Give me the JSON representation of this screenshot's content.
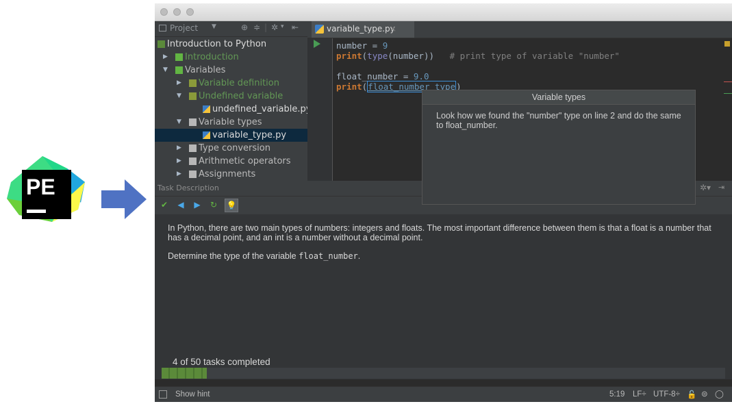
{
  "logo": {
    "text": "PE"
  },
  "window": {
    "project_panel": {
      "label": "Project",
      "tree": [
        {
          "label": "Introduction to Python",
          "depth": 0,
          "arrow": "",
          "style": "course"
        },
        {
          "label": "Introduction",
          "depth": 1,
          "arrow": "▶",
          "style": "green"
        },
        {
          "label": "Variables",
          "depth": 1,
          "arrow": "▼",
          "style": "normal"
        },
        {
          "label": "Variable definition",
          "depth": 2,
          "arrow": "▶",
          "style": "green"
        },
        {
          "label": "Undefined variable",
          "depth": 2,
          "arrow": "▼",
          "style": "green"
        },
        {
          "label": "undefined_variable.py",
          "depth": 3,
          "arrow": "",
          "style": "file"
        },
        {
          "label": "Variable types",
          "depth": 2,
          "arrow": "▼",
          "style": "normal"
        },
        {
          "label": "variable_type.py",
          "depth": 3,
          "arrow": "",
          "style": "file-selected"
        },
        {
          "label": "Type conversion",
          "depth": 2,
          "arrow": "▶",
          "style": "normal"
        },
        {
          "label": "Arithmetic operators",
          "depth": 2,
          "arrow": "▶",
          "style": "normal"
        },
        {
          "label": "Assignments",
          "depth": 2,
          "arrow": "▶",
          "style": "normal"
        }
      ]
    },
    "editor": {
      "tab_label": "variable_type.py",
      "code": {
        "line1": {
          "var": "number",
          "eq": " = ",
          "num": "9"
        },
        "line2": {
          "kw": "print",
          "p1": "(",
          "bi": "type",
          "p2": "(number))",
          "cmt": "   # print type of variable \"number\""
        },
        "line4": {
          "var": "float_number",
          "eq": " = ",
          "num": "9.0"
        },
        "line5": {
          "kw": "print",
          "p1": "(",
          "placeholder": "float_number type",
          "p2": ")"
        }
      }
    },
    "popup": {
      "title": "Variable types",
      "body": "Look how we found the \"number\" type on line 2 and do the same to float_number."
    },
    "task": {
      "header": "Task Description",
      "para1": "In Python, there are two main types of numbers: integers and floats. The most important difference between them is that a float is a number that has a decimal point, and an int is a number without a decimal point.",
      "para2_prefix": "Determine the type of the variable ",
      "para2_code": "float_number",
      "para2_suffix": ".",
      "progress_label": "4 of 50 tasks completed",
      "progress_fraction": 0.08
    },
    "statusbar": {
      "hint_label": "Show hint",
      "position": "5:19",
      "line_sep": "LF÷",
      "encoding": "UTF-8÷"
    }
  }
}
